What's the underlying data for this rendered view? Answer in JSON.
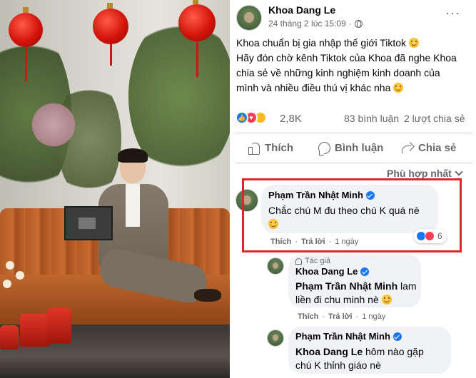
{
  "post": {
    "author": "Khoa Dang Le",
    "timestamp": "24 tháng 2 lúc 15:09",
    "privacy_icon": "globe-icon",
    "more_label": "···",
    "text_lines": [
      "Khoa chuẩn bị gia nhập thế giới Tiktok",
      "Hãy đón chờ kênh Tiktok của Khoa đã nghe Khoa",
      "chia sẻ về những kinh nghiệm kinh doanh của",
      "mình và nhiều điều thú vị khác nha"
    ],
    "reaction_count": "2,8K",
    "comment_count": "83 bình luận",
    "share_count": "2 lượt chia sẻ",
    "actions": {
      "like": "Thích",
      "comment": "Bình luận",
      "share": "Chia sẻ"
    },
    "sort_label": "Phù hợp nhất"
  },
  "comments": [
    {
      "name": "Phạm Trần Nhật Minh",
      "text": "Chắc chú M đu theo chú K quá nè",
      "reaction_count": "6",
      "like_label": "Thích",
      "reply_label": "Trả lời",
      "time": "1 ngày"
    }
  ],
  "replies": [
    {
      "tag": "Tác giả",
      "name": "Khoa Dang Le",
      "mention": "Phạm Trần Nhật Minh",
      "text_line1_suffix": " lam",
      "text_line2": "liền đi chu minh nè",
      "like_label": "Thích",
      "reply_label": "Trả lời",
      "time": "1 ngày"
    },
    {
      "name": "Phạm Trần Nhật Minh",
      "mention": "Khoa Dang Le",
      "text_line1_suffix": " hôm nào gặp",
      "text_line2": "chú K thỉnh giáo nè"
    }
  ],
  "colors": {
    "facebook_blue": "#1877f2",
    "love_red": "#f33e58",
    "highlight_red": "#e3232c",
    "bubble_gray": "#f0f2f5",
    "muted_text": "#65676b"
  }
}
